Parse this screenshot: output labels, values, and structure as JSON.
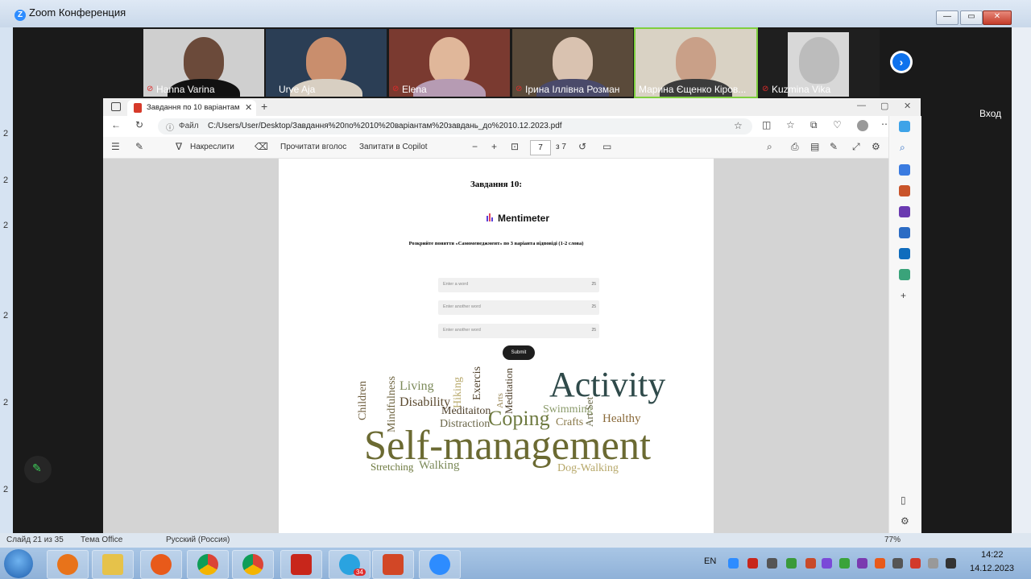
{
  "zoom": {
    "title": "Zoom Конференция",
    "participants": [
      {
        "name": "Hanna Varina",
        "muted": true
      },
      {
        "name": "Urve Aja",
        "muted": false
      },
      {
        "name": "Elena",
        "muted": true
      },
      {
        "name": "Ірина Іллівна Розман",
        "muted": true
      },
      {
        "name": "Марина Єщенко Кіров...",
        "muted": false
      },
      {
        "name": "Kuzmina Vika",
        "muted": true
      }
    ],
    "right_label": "Вход",
    "side_numbers": [
      "2",
      "2",
      "2",
      "2",
      "2",
      "2"
    ]
  },
  "browser": {
    "tab_title": "Завдання по 10 варіантам завд...",
    "url_label": "Файл",
    "url": "C:/Users/User/Desktop/Завдання%20по%2010%20варіантам%20завдань_до%2010.12.2023.pdf",
    "toolbar": {
      "draw": "Накреслити",
      "read_aloud": "Прочитати вголос",
      "ask_copilot": "Запитати в Copilot",
      "page": "7",
      "page_total": "з 7"
    }
  },
  "document": {
    "task_title": "Завдання 10:",
    "brand": "Mentimeter",
    "instruction": "Розкрийте поняття «Самоменеджмент» по 3 варіанта відповіді (1-2 слова)",
    "fields": [
      {
        "placeholder": "Enter a word",
        "counter": "25"
      },
      {
        "placeholder": "Enter another word",
        "counter": "25"
      },
      {
        "placeholder": "Enter another word",
        "counter": "25"
      }
    ],
    "submit": "Submit",
    "word_cloud": [
      "Children",
      "Mindfulness",
      "Living",
      "Disability",
      "Hiking",
      "Exercis",
      "Meditaiton",
      "Distraction",
      "Arts",
      "Meditation",
      "Coping",
      "Activity",
      "Swimming",
      "Crafts",
      "Art Set",
      "Healthy",
      "Self-management",
      "Stretching",
      "Walking",
      "Dog-Walking"
    ]
  },
  "status_bar": {
    "slide": "Слайд 21 из 35",
    "theme": "Тема Office",
    "language": "Русский (Россия)",
    "zoom_level": "77%"
  },
  "taskbar": {
    "lang": "EN",
    "time": "14:22",
    "date": "14.12.2023",
    "telegram_badge": "34"
  }
}
